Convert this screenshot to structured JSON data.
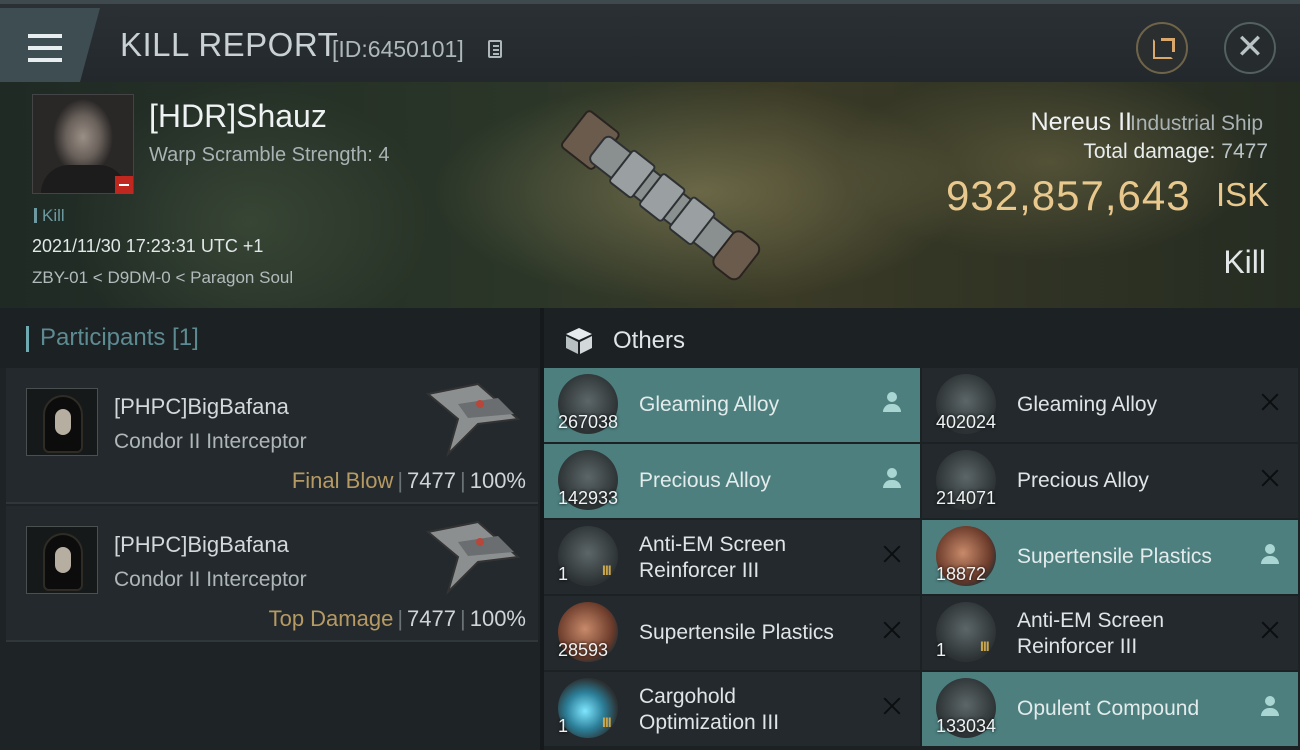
{
  "window": {
    "title": "KILL REPORT",
    "report_id": "[ID:6450101]"
  },
  "victim": {
    "name": "[HDR]Shauz",
    "warp_scramble": "Warp Scramble Strength: 4",
    "kill_tag": "Kill",
    "datetime": "2021/11/30 17:23:31 UTC +1",
    "location": "ZBY-01 < D9DM-0 < Paragon Soul",
    "ship_name": "Nereus II",
    "ship_class": "Industrial Ship",
    "total_damage_label": "Total damage:",
    "total_damage_value": "7477",
    "isk_value": "932,857,643",
    "isk_unit": "ISK",
    "result": "Kill"
  },
  "participants": {
    "header": "Participants [1]",
    "entries": [
      {
        "name": "[PHPC]BigBafana",
        "ship": "Condor II Interceptor",
        "tag": "Final Blow",
        "damage": "7477",
        "percent": "100%"
      },
      {
        "name": "[PHPC]BigBafana",
        "ship": "Condor II Interceptor",
        "tag": "Top Damage",
        "damage": "7477",
        "percent": "100%"
      }
    ]
  },
  "items": {
    "header": "Others",
    "left": [
      {
        "name": "Gleaming Alloy",
        "qty": "267038",
        "status": "dropped",
        "icon": "alloy-icon"
      },
      {
        "name": "Precious Alloy",
        "qty": "142933",
        "status": "dropped",
        "icon": "crystal-icon"
      },
      {
        "name": "Anti-EM Screen Reinforcer III",
        "name_l1": "Anti-EM Screen",
        "name_l2": "Reinforcer III",
        "qty": "1",
        "tier": "III",
        "status": "destroyed",
        "icon": "shield-rig-icon"
      },
      {
        "name": "Supertensile Plastics",
        "qty": "28593",
        "status": "destroyed",
        "icon": "plastics-icon"
      },
      {
        "name": "Cargohold Optimization III",
        "name_l1": "Cargohold",
        "name_l2": "Optimization III",
        "qty": "1",
        "tier": "III",
        "status": "destroyed",
        "icon": "cargo-rig-icon"
      }
    ],
    "right": [
      {
        "name": "Gleaming Alloy",
        "qty": "402024",
        "status": "destroyed",
        "icon": "alloy-icon"
      },
      {
        "name": "Precious Alloy",
        "qty": "214071",
        "status": "destroyed",
        "icon": "crystal-icon"
      },
      {
        "name": "Supertensile Plastics",
        "qty": "18872",
        "status": "dropped",
        "icon": "plastics-icon"
      },
      {
        "name": "Anti-EM Screen Reinforcer III",
        "name_l1": "Anti-EM Screen",
        "name_l2": "Reinforcer III",
        "qty": "1",
        "tier": "III",
        "status": "destroyed",
        "icon": "shield-rig-icon"
      },
      {
        "name": "Opulent Compound",
        "qty": "133034",
        "status": "dropped",
        "icon": "compound-icon"
      }
    ]
  },
  "colors": {
    "isk_gold": "#e8c88d",
    "dropped_bg": "#4d7f7f",
    "destroyed_bg": "#23292c",
    "accent_teal": "#6faab3"
  }
}
